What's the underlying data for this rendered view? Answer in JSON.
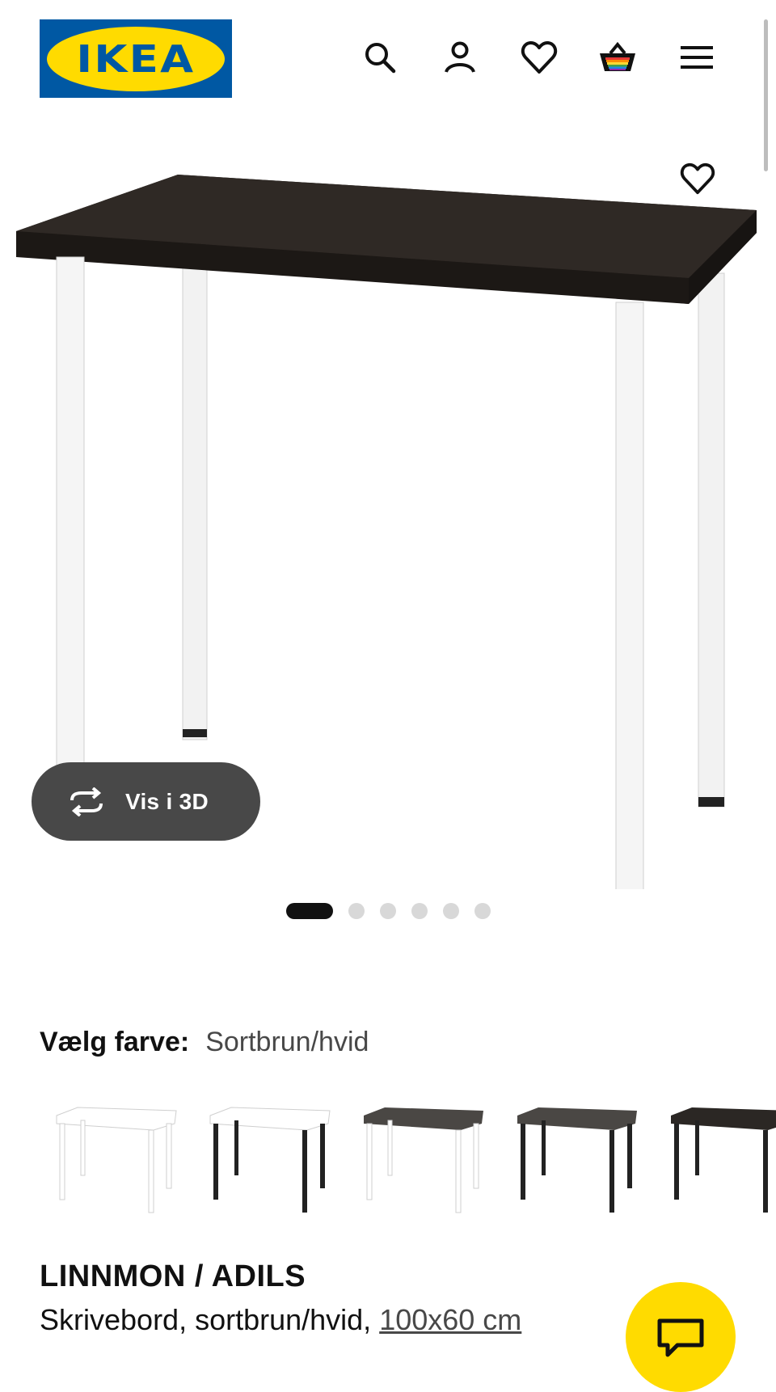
{
  "header": {
    "logo_text": "IKEA",
    "logo_reg": "®",
    "icons": [
      "search-icon",
      "account-icon",
      "heart-icon",
      "basket-icon",
      "menu-icon"
    ]
  },
  "product_image": {
    "favorite_icon": "heart-icon",
    "view_3d_label": "Vis i 3D",
    "view_3d_icon": "rotate-icon"
  },
  "carousel": {
    "total": 6,
    "active_index": 0
  },
  "color_choice": {
    "key": "Vælg farve:",
    "value": "Sortbrun/hvid",
    "swatches": [
      {
        "top": "#ffffff",
        "legs": "#ffffff"
      },
      {
        "top": "#ffffff",
        "legs": "#222222"
      },
      {
        "top": "#4a4744",
        "legs": "#ffffff"
      },
      {
        "top": "#4a4744",
        "legs": "#222222"
      },
      {
        "top": "#2b2724",
        "legs": "#222222"
      }
    ]
  },
  "product": {
    "name": "LINNMON / ADILS",
    "description": "Skrivebord, sortbrun/hvid, ",
    "size": "100x60 cm"
  },
  "colors": {
    "brand_blue": "#0058a3",
    "brand_yellow": "#ffdb00",
    "dark_button": "#484848"
  }
}
